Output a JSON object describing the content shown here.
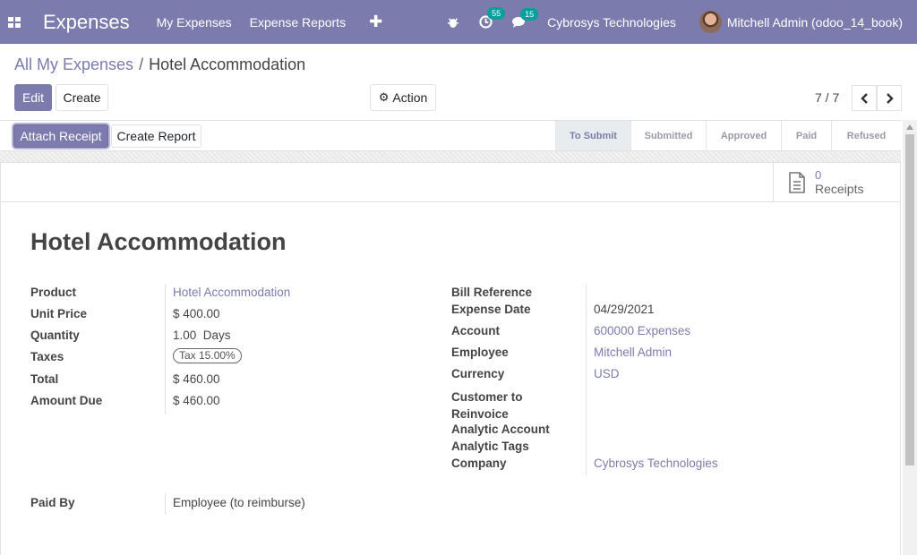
{
  "navbar": {
    "brand": "Expenses",
    "menu": [
      "My Expenses",
      "Expense Reports"
    ],
    "activity_count": "55",
    "message_count": "15",
    "company": "Cybrosys Technologies",
    "user": "Mitchell Admin (odoo_14_book)"
  },
  "breadcrumb": {
    "parent": "All My Expenses",
    "separator": "/",
    "current": "Hotel Accommodation"
  },
  "controls": {
    "edit": "Edit",
    "create": "Create",
    "action": "Action",
    "pager": "7 / 7"
  },
  "statusbar": {
    "attach_receipt": "Attach Receipt",
    "create_report": "Create Report",
    "stages": [
      "To Submit",
      "Submitted",
      "Approved",
      "Paid",
      "Refused"
    ],
    "active_stage": "To Submit"
  },
  "smart_button": {
    "value": "0",
    "label": "Receipts"
  },
  "form": {
    "title": "Hotel Accommodation",
    "left": [
      {
        "label": "Product",
        "value": "Hotel Accommodation"
      },
      {
        "label": "Unit Price",
        "value": "$ 400.00"
      },
      {
        "label": "Quantity",
        "value": "1.00  Days"
      },
      {
        "label": "Taxes",
        "value": "Tax 15.00%"
      },
      {
        "label": "Total",
        "value": "$ 460.00"
      },
      {
        "label": "Amount Due",
        "value": "$ 460.00"
      }
    ],
    "right": [
      {
        "label": "Bill Reference",
        "value": ""
      },
      {
        "label": "Expense Date",
        "value": "04/29/2021"
      },
      {
        "label": "Account",
        "value": "600000 Expenses"
      },
      {
        "label": "Employee",
        "value": "Mitchell Admin"
      },
      {
        "label": "Currency",
        "value": "USD"
      },
      {
        "label": "Customer to Reinvoice",
        "value": ""
      },
      {
        "label": "Analytic Account",
        "value": ""
      },
      {
        "label": "Analytic Tags",
        "value": ""
      },
      {
        "label": "Company",
        "value": "Cybrosys Technologies"
      }
    ],
    "paid_by": {
      "label": "Paid By",
      "value": "Employee (to reimburse)"
    }
  },
  "colors": {
    "primary": "#7c7bad",
    "badge": "#00a09d"
  }
}
